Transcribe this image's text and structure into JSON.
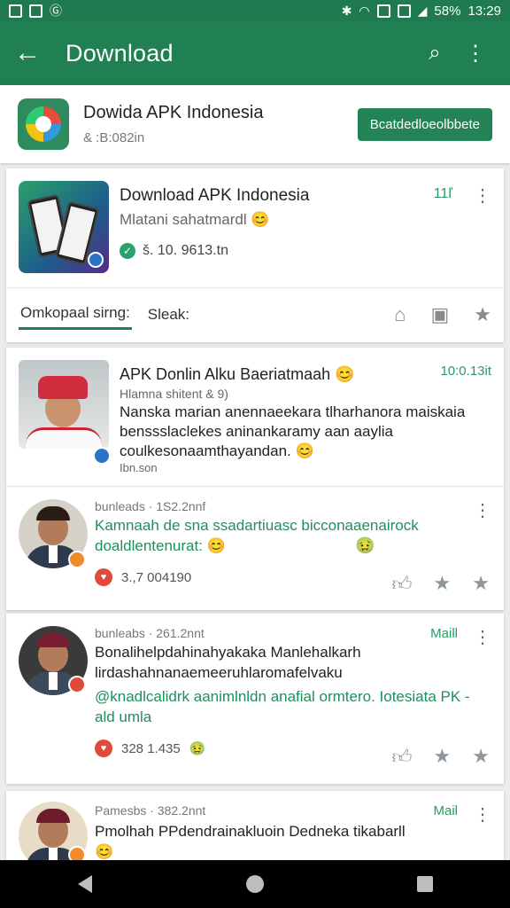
{
  "status_bar": {
    "battery": "58%",
    "time": "13:29"
  },
  "appbar": {
    "title": "Download"
  },
  "app_header": {
    "name": "Dowida APK Indonesia",
    "size": "& :B:082in",
    "button_label": "Bcatdedloeolbbete"
  },
  "featured": {
    "title": "Download APK Indonesia",
    "subtitle": "Mlatani sahatmardl 😊",
    "version": "š. 10. 9613.tn",
    "count": "11ľ",
    "tabs": [
      {
        "label": "Omkopaal sirng:"
      },
      {
        "label": "Sleak:"
      }
    ]
  },
  "news": {
    "title": "APK Donlin Alku Baeriatmaah 😊",
    "subtitle": "Hlamna shitent & 9)",
    "body": "Nanska marian anennaeekara tlharhanora maiskaia benssslaclekes aninankaramy aan aaylia coulkesonaamthayandan. 😊",
    "footer": "Ibn.son",
    "time": "10:0.13it"
  },
  "comments": [
    {
      "author_line": "bunleads · 1S2.2nnf",
      "text": "Kamnaah de sna ssadartiuasc bicconaaenairock doaldlentenurat: 😊",
      "emoji_right": "🤢",
      "likes": "3.,7 004190",
      "time": ""
    },
    {
      "author_line": "bunleabs · 261.2nnt",
      "text_dark": "Bonalihelpdahinahyakaka Manlehalkarh lirdashahnanaemeeruhlaromafelvaku",
      "text_green": "@knadlcalidrk aanimlnldn anafial ormtero. Iotesiata PK -ald umla",
      "likes": "328 1.435",
      "emoji_like": "🤢",
      "time": "Maill"
    },
    {
      "author_line": "Pamesbs · 382.2nnt",
      "text_dark": "Pmolhah PPdendrainakluoin Dedneka tikabarll 😊",
      "time": "Mail"
    }
  ]
}
